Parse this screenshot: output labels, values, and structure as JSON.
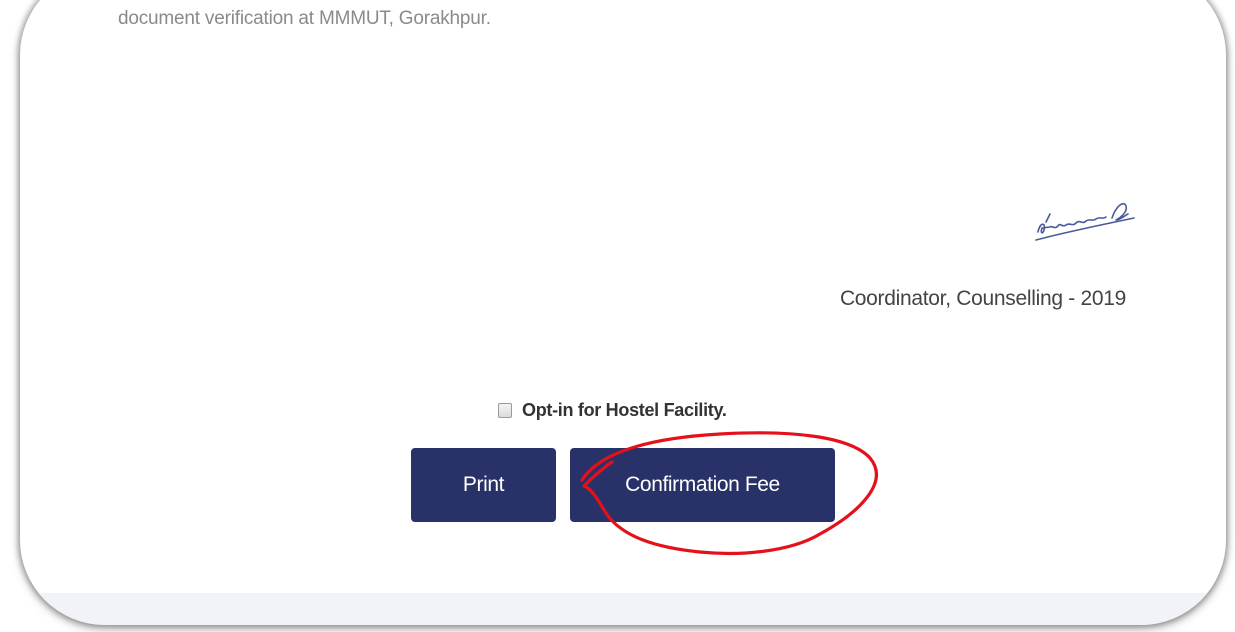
{
  "colors": {
    "button_bg": "#283268",
    "annotation_red": "#e4101a",
    "signature_ink": "#4a5a9a"
  },
  "document": {
    "intro_text": "document verification at MMMUT, Gorakhpur.",
    "signature": "handwritten-signature",
    "coordinator_text": "Coordinator, Counselling - 2019"
  },
  "hostel_option": {
    "checked": false,
    "label": "Opt-in for Hostel Facility."
  },
  "actions": {
    "print_label": "Print",
    "confirmation_fee_label": "Confirmation Fee"
  },
  "annotation": {
    "shape": "red-hand-drawn-circle",
    "target": "confirmation-fee-button"
  }
}
